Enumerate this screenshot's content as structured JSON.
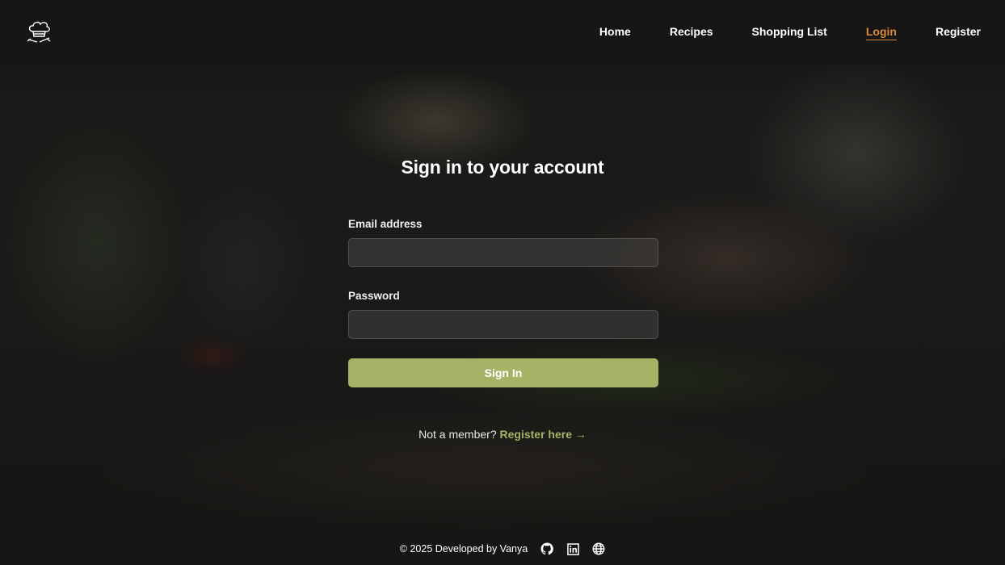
{
  "nav": {
    "links": [
      {
        "label": "Home"
      },
      {
        "label": "Recipes"
      },
      {
        "label": "Shopping List"
      },
      {
        "label": "Login",
        "active": true
      },
      {
        "label": "Register"
      }
    ]
  },
  "login": {
    "title": "Sign in to your account",
    "email_label": "Email address",
    "email_value": "",
    "password_label": "Password",
    "password_value": "",
    "submit_label": "Sign In",
    "member_text": "Not a member?",
    "register_link": "Register here →"
  },
  "footer": {
    "text": "© 2025 Developed by Vanya",
    "icons": [
      "github-icon",
      "linkedin-icon",
      "globe-icon"
    ]
  },
  "colors": {
    "accent": "#a6b265",
    "active_nav": "#d8893f",
    "navbar_bg": "#171616"
  }
}
